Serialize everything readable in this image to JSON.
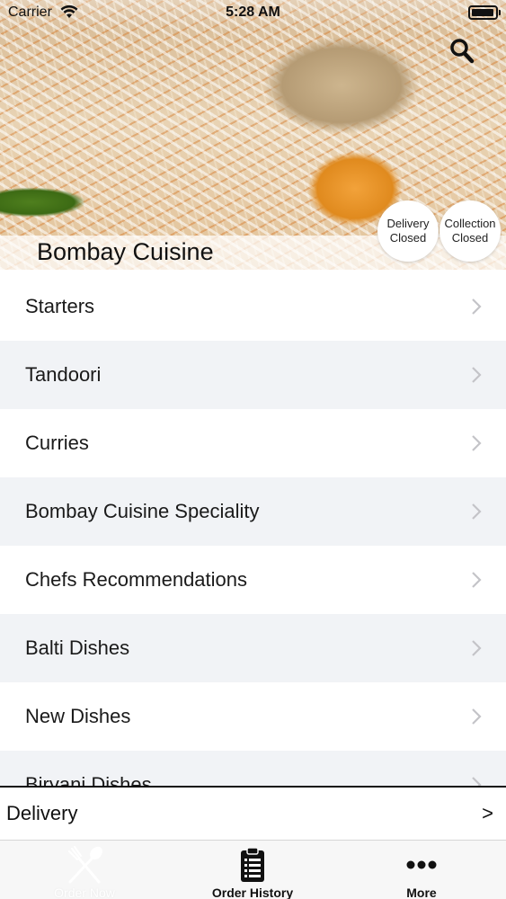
{
  "status_bar": {
    "carrier": "Carrier",
    "time": "5:28 AM"
  },
  "header": {
    "restaurant_name": "Bombay Cuisine",
    "delivery_status": {
      "line1": "Delivery",
      "line2": "Closed"
    },
    "collection_status": {
      "line1": "Collection",
      "line2": "Closed"
    }
  },
  "menu": {
    "items": [
      {
        "label": "Starters"
      },
      {
        "label": "Tandoori"
      },
      {
        "label": "Curries"
      },
      {
        "label": "Bombay Cuisine Speciality"
      },
      {
        "label": "Chefs Recommendations"
      },
      {
        "label": "Balti Dishes"
      },
      {
        "label": "New Dishes"
      },
      {
        "label": "Biryani Dishes"
      }
    ]
  },
  "order_mode": {
    "label": "Delivery",
    "arrow": ">"
  },
  "tab_bar": {
    "tabs": [
      {
        "label": "Order Now",
        "icon": "fork-spoon-icon"
      },
      {
        "label": "Order History",
        "icon": "clipboard-list-icon"
      },
      {
        "label": "More",
        "icon": "more-dots-icon"
      }
    ]
  },
  "colors": {
    "row_alt": "#f1f3f6",
    "text": "#1a1a1a",
    "tab_bar_bg": "#f7f7f7"
  }
}
